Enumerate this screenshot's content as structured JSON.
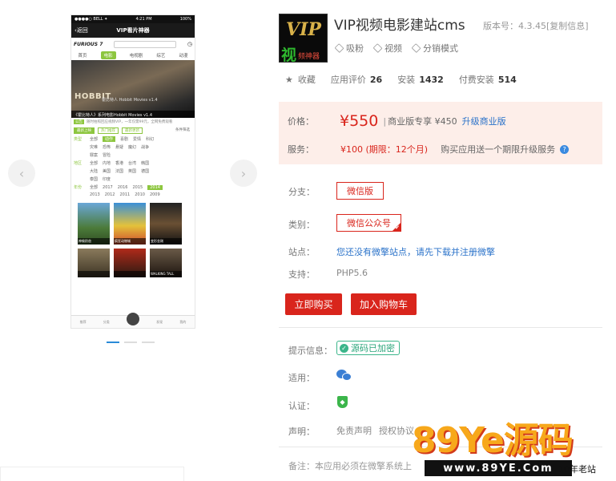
{
  "phone": {
    "status_carrier": "●●●●○ BELL ✦",
    "status_time": "4:21 PM",
    "status_battery": "100%",
    "nav_back": "‹返回",
    "nav_title": "VIP看片神器",
    "logo": "FURIOUS 7",
    "tabs": [
      "首页",
      "电影",
      "电视剧",
      "综艺",
      "动漫"
    ],
    "active_tab_index": 1,
    "banner_title": "HOBBIT",
    "banner_sub": "霍比特人 Hobbit Movies v1.4",
    "banner_caption": "《霍比特人》系列电影Hobbit Movies v1.4",
    "notice_tag": "公告",
    "notice_text": "随时拍照回应视频VIP，一年仅需99元，全网免费观看",
    "filter_buttons": [
      "最新上映",
      "热门推荐",
      "最新更新"
    ],
    "filter_more": "条件筛选",
    "filter_row1_label": "类型",
    "filter_row1": [
      "全部",
      "动作",
      "喜剧",
      "爱情",
      "科幻"
    ],
    "filter_row1b": [
      "灾难",
      "恐怖",
      "悬疑",
      "魔幻",
      "战争"
    ],
    "filter_row1c": [
      "罪案",
      "冒险"
    ],
    "filter_row2_label": "地区",
    "filter_row2": [
      "全部",
      "内地",
      "香港",
      "台湾",
      "韩国"
    ],
    "filter_row2b": [
      "大陆",
      "美国",
      "法国",
      "英国",
      "德国"
    ],
    "filter_row2c": [
      "泰国",
      "印度"
    ],
    "filter_row3_label": "年份",
    "filter_row3": [
      "全部",
      "2017",
      "2016",
      "2015",
      "2014"
    ],
    "filter_row3b": [
      "2013",
      "2012",
      "2011",
      "2010",
      "2009"
    ],
    "poster_labels": [
      "神偷奶爸",
      "疯狂动物城",
      "变形金刚"
    ],
    "poster_labels2": [
      "",
      "",
      "WALKING TALL"
    ],
    "footer": [
      "推荐",
      "分类",
      "",
      "发现",
      "我的"
    ]
  },
  "gallery": {
    "prev_icon": "chevron-left-icon",
    "next_icon": "chevron-right-icon"
  },
  "app": {
    "icon_text_1": "VIP",
    "icon_text_2": "视",
    "icon_text_3": "频神器",
    "title": "VIP视频电影建站cms",
    "version_label": "版本号：4.3.45",
    "copy_info": "[复制信息]",
    "tags": [
      "吸粉",
      "视频",
      "分销模式"
    ],
    "favorite": "收藏",
    "rating_label": "应用评价",
    "rating_value": "26",
    "install_label": "安装",
    "install_value": "1432",
    "paid_install_label": "付费安装",
    "paid_install_value": "514"
  },
  "price": {
    "price_label": "价格：",
    "price_value": "¥550",
    "commercial_text": "商业版专享 ¥450",
    "upgrade_link": "升级商业版",
    "service_label": "服务：",
    "service_value": "¥100 (期限：12个月)",
    "service_desc": "购买应用送一个期限升级服务",
    "help_icon": "?"
  },
  "fields": {
    "branch_label": "分支：",
    "branch_value": "微信版",
    "category_label": "类别：",
    "category_value": "微信公众号",
    "site_label": "站点：",
    "site_value": "您还没有微擎站点，请先下载并注册微擎",
    "support_label": "支持：",
    "support_value": "PHP5.6"
  },
  "buttons": {
    "buy_now": "立即购买",
    "add_cart": "加入购物车"
  },
  "info": {
    "tip_label": "提示信息：",
    "encrypted_badge": "源码已加密",
    "apply_label": "适用：",
    "cert_label": "认证：",
    "decl_label": "声明：",
    "disclaimer": "免责声明",
    "license": "授权协议",
    "remark": "备注：本应用必须在微擎系统上"
  },
  "watermark": {
    "brand": "89Ye源码",
    "url": "www.89YE.Com",
    "years": "10年老站"
  },
  "colors": {
    "accent_red": "#d9251c",
    "link_blue": "#2a72c9",
    "price_bg": "#fdeee9",
    "green": "#3bb58a"
  }
}
